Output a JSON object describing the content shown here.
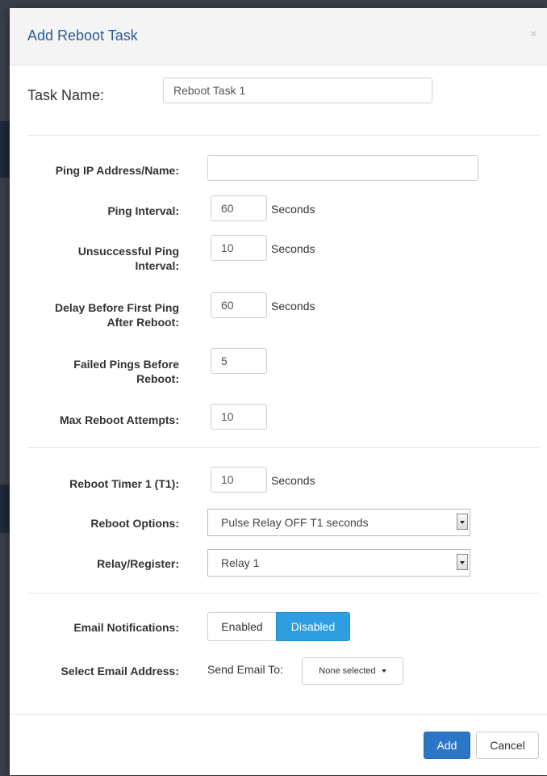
{
  "modal": {
    "title": "Add Reboot Task",
    "close_symbol": "×"
  },
  "task_name": {
    "label": "Task Name:",
    "value": "Reboot Task 1"
  },
  "ping": {
    "ip_label": "Ping IP Address/Name:",
    "ip_value": "",
    "interval_label": "Ping Interval:",
    "interval_value": "60",
    "interval_unit": "Seconds",
    "unsuccessful_label_line1": "Unsuccessful Ping",
    "unsuccessful_label_line2": "Interval:",
    "unsuccessful_value": "10",
    "unsuccessful_unit": "Seconds",
    "delay_label_line1": "Delay Before First Ping",
    "delay_label_line2": "After Reboot:",
    "delay_value": "60",
    "delay_unit": "Seconds",
    "failed_label_line1": "Failed Pings Before",
    "failed_label_line2": "Reboot:",
    "failed_value": "5",
    "max_attempts_label": "Max Reboot Attempts:",
    "max_attempts_value": "10"
  },
  "reboot": {
    "timer_label": "Reboot Timer 1 (T1):",
    "timer_value": "10",
    "timer_unit": "Seconds",
    "options_label": "Reboot Options:",
    "options_selected": "Pulse Relay OFF T1 seconds",
    "relay_label": "Relay/Register:",
    "relay_selected": "Relay 1"
  },
  "email": {
    "notifications_label": "Email Notifications:",
    "enabled_label": "Enabled",
    "disabled_label": "Disabled",
    "select_label": "Select Email Address:",
    "send_to_label": "Send Email To:",
    "dropdown_value": "None selected"
  },
  "footer": {
    "add_label": "Add",
    "cancel_label": "Cancel"
  },
  "colors": {
    "title": "#2c5d93",
    "toggle_active": "#2d9ee0",
    "primary_button": "#2d75c6"
  }
}
